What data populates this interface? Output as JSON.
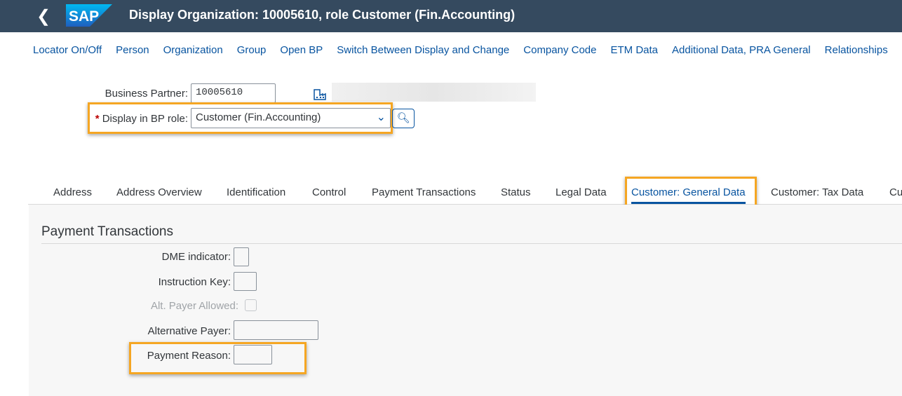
{
  "shell": {
    "title": "Display Organization: 10005610, role Customer (Fin.Accounting)",
    "logo": "SAP"
  },
  "toolbar": [
    "Locator On/Off",
    "Person",
    "Organization",
    "Group",
    "Open BP",
    "Switch Between Display and Change",
    "Company Code",
    "ETM Data",
    "Additional Data, PRA General",
    "Relationships"
  ],
  "header": {
    "bp_label": "Business Partner:",
    "bp_value": "10005610",
    "role_label": "Display in BP role:",
    "role_required": "*",
    "role_value": "Customer (Fin.Accounting)"
  },
  "tabs": [
    "Address",
    "Address Overview",
    "Identification",
    "Control",
    "Payment Transactions",
    "Status",
    "Legal Data",
    "Customer: General Data",
    "Customer: Tax Data",
    "Cu"
  ],
  "selected_tab": "Customer: General Data",
  "section": {
    "title": "Payment Transactions",
    "fields": [
      "DME indicator:",
      "Instruction Key:",
      "Alt. Payer Allowed:",
      "Alternative Payer:",
      "Payment Reason:"
    ]
  },
  "colors": {
    "shell": "#354a5f",
    "highlight": "#f5a623",
    "link": "#0854a0"
  }
}
